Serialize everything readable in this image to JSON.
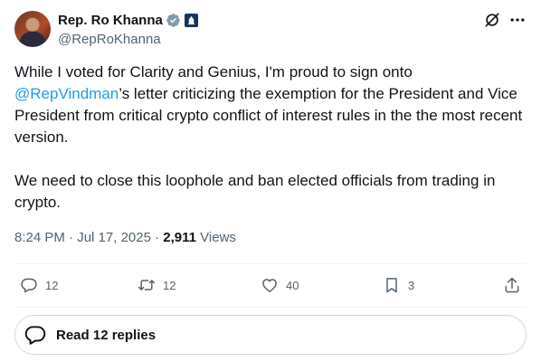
{
  "author": {
    "display_name": "Rep. Ro Khanna",
    "handle": "@RepRoKhanna",
    "verified_color": "#829aab"
  },
  "tweet": {
    "text_before_mention": "While I voted for Clarity and Genius, I'm proud to sign onto ",
    "mention": "@RepVindman",
    "text_after_mention": "’s letter criticizing the exemption for the President and Vice President from critical crypto conflict of interest rules in the the most recent version.",
    "paragraph2": "We need to close this loophole and ban elected officials from trading in crypto."
  },
  "meta": {
    "time": "8:24 PM",
    "separator": " · ",
    "date": "Jul 17, 2025",
    "views_count": "2,911",
    "views_label": " Views"
  },
  "actions": {
    "replies": "12",
    "reposts": "12",
    "likes": "40",
    "bookmarks": "3"
  },
  "read_replies": {
    "label": "Read 12 replies"
  },
  "colors": {
    "accent": "#1d9bf0",
    "text": "#0f1419",
    "muted": "#536471",
    "border": "#cfd9de"
  }
}
